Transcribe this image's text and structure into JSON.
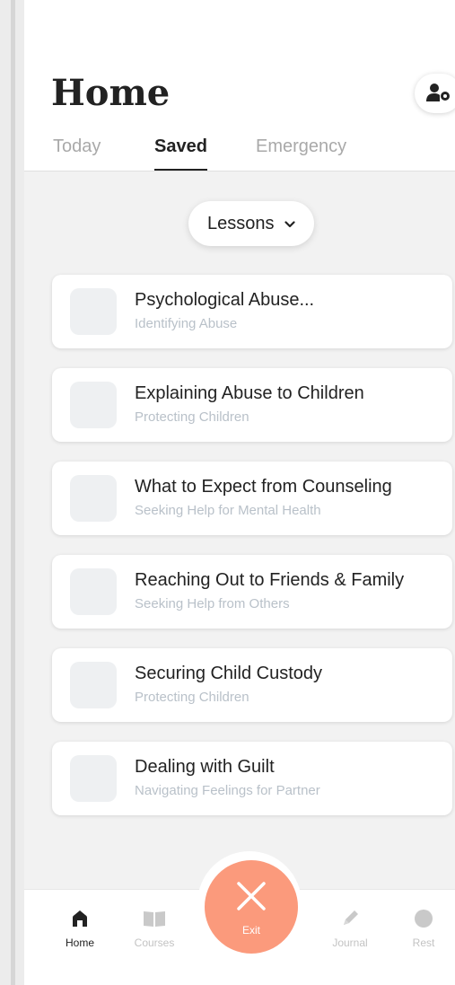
{
  "header": {
    "title": "Home"
  },
  "tabs": [
    {
      "label": "Today"
    },
    {
      "label": "Saved"
    },
    {
      "label": "Emergency"
    }
  ],
  "active_tab": "Saved",
  "filter": {
    "label": "Lessons"
  },
  "lessons": [
    {
      "title": "Psychological Abuse...",
      "subtitle": "Identifying Abuse"
    },
    {
      "title": "Explaining Abuse to Children",
      "subtitle": "Protecting Children"
    },
    {
      "title": "What to Expect from Counseling",
      "subtitle": "Seeking Help for Mental Health"
    },
    {
      "title": "Reaching Out to Friends & Family",
      "subtitle": "Seeking Help from Others"
    },
    {
      "title": "Securing Child Custody",
      "subtitle": "Protecting Children"
    },
    {
      "title": "Dealing with Guilt",
      "subtitle": "Navigating Feelings for Partner"
    }
  ],
  "bottom_nav": {
    "items": [
      {
        "label": "Home",
        "icon": "home-icon"
      },
      {
        "label": "Courses",
        "icon": "book-icon"
      },
      {
        "label": "Journal",
        "icon": "pencil-icon"
      },
      {
        "label": "Rest",
        "icon": "circle-icon"
      }
    ],
    "exit": {
      "label": "Exit",
      "icon": "close-icon"
    }
  },
  "colors": {
    "accent": "#fb9a7c",
    "text": "#222222",
    "muted": "#a9a9a9",
    "subtitle": "#b9c1c9",
    "background": "#f2f2f2"
  }
}
